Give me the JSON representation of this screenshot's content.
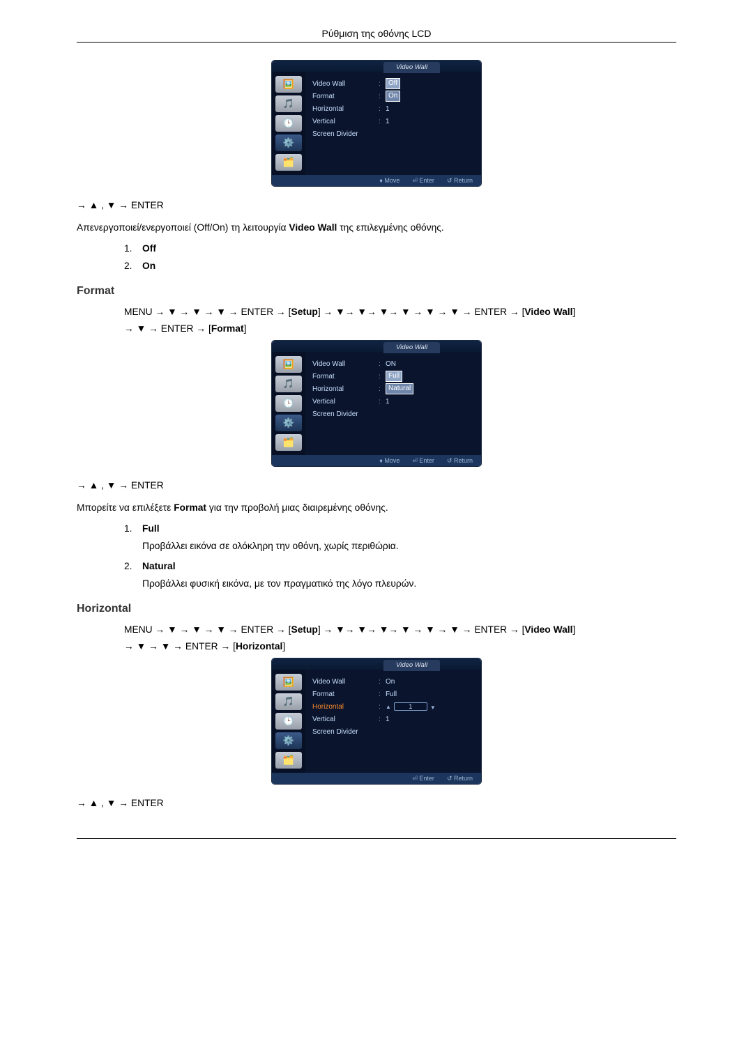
{
  "page_title": "Ρύθμιση της οθόνης LCD",
  "osd_title": "Video Wall",
  "osd_rows": {
    "video_wall_label": "Video Wall",
    "format_label": "Format",
    "horizontal_label": "Horizontal",
    "vertical_label": "Vertical",
    "screen_divider_label": "Screen Divider"
  },
  "osd_footer": {
    "move": "Move",
    "enter": "Enter",
    "return": "Return"
  },
  "osd1": {
    "video_wall_value_a": "Off",
    "video_wall_value_b": "On",
    "horizontal_value": "1",
    "vertical_value": "1"
  },
  "osd2": {
    "video_wall_value": "ON",
    "format_value_a": "Full",
    "format_value_b": "Natural",
    "vertical_value": "1"
  },
  "osd3": {
    "video_wall_value": "On",
    "format_value": "Full",
    "horizontal_value": "1",
    "vertical_value": "1"
  },
  "nav": {
    "arrows_enter": "→ ▲ , ▼ → ENTER",
    "menu_prefix": "MENU → ▼ → ▼ → ▼ → ENTER →",
    "setup_word": "Setup",
    "mid": "→ ▼→ ▼→ ▼→ ▼ → ▼ → ▼ → ENTER →",
    "videowall_word": "Video Wall",
    "format_line2_prefix": "→ ▼ → ENTER →",
    "format_word": "Format",
    "horizontal_line2_prefix": "→ ▼ → ▼ → ENTER →",
    "horizontal_word": "Horizontal"
  },
  "text": {
    "desc_offon_a": "Απενεργοποιεί/ενεργοποιεί (Off/On) τη λειτουργία ",
    "desc_offon_b": " της επιλεγμένης οθόνης.",
    "videowall_bold": "Video Wall",
    "off": "Off",
    "on": "On",
    "format_heading": "Format",
    "format_intro_a": "Μπορείτε να επιλέξετε ",
    "format_bold": "Format",
    "format_intro_b": " για την προβολή μιας διαιρεμένης οθόνης.",
    "full": "Full",
    "full_desc": "Προβάλλει εικόνα σε ολόκληρη την οθόνη, χωρίς περιθώρια.",
    "natural": "Natural",
    "natural_desc": "Προβάλλει φυσική εικόνα, με τον πραγματικό της λόγο πλευρών.",
    "horizontal_heading": "Horizontal"
  }
}
